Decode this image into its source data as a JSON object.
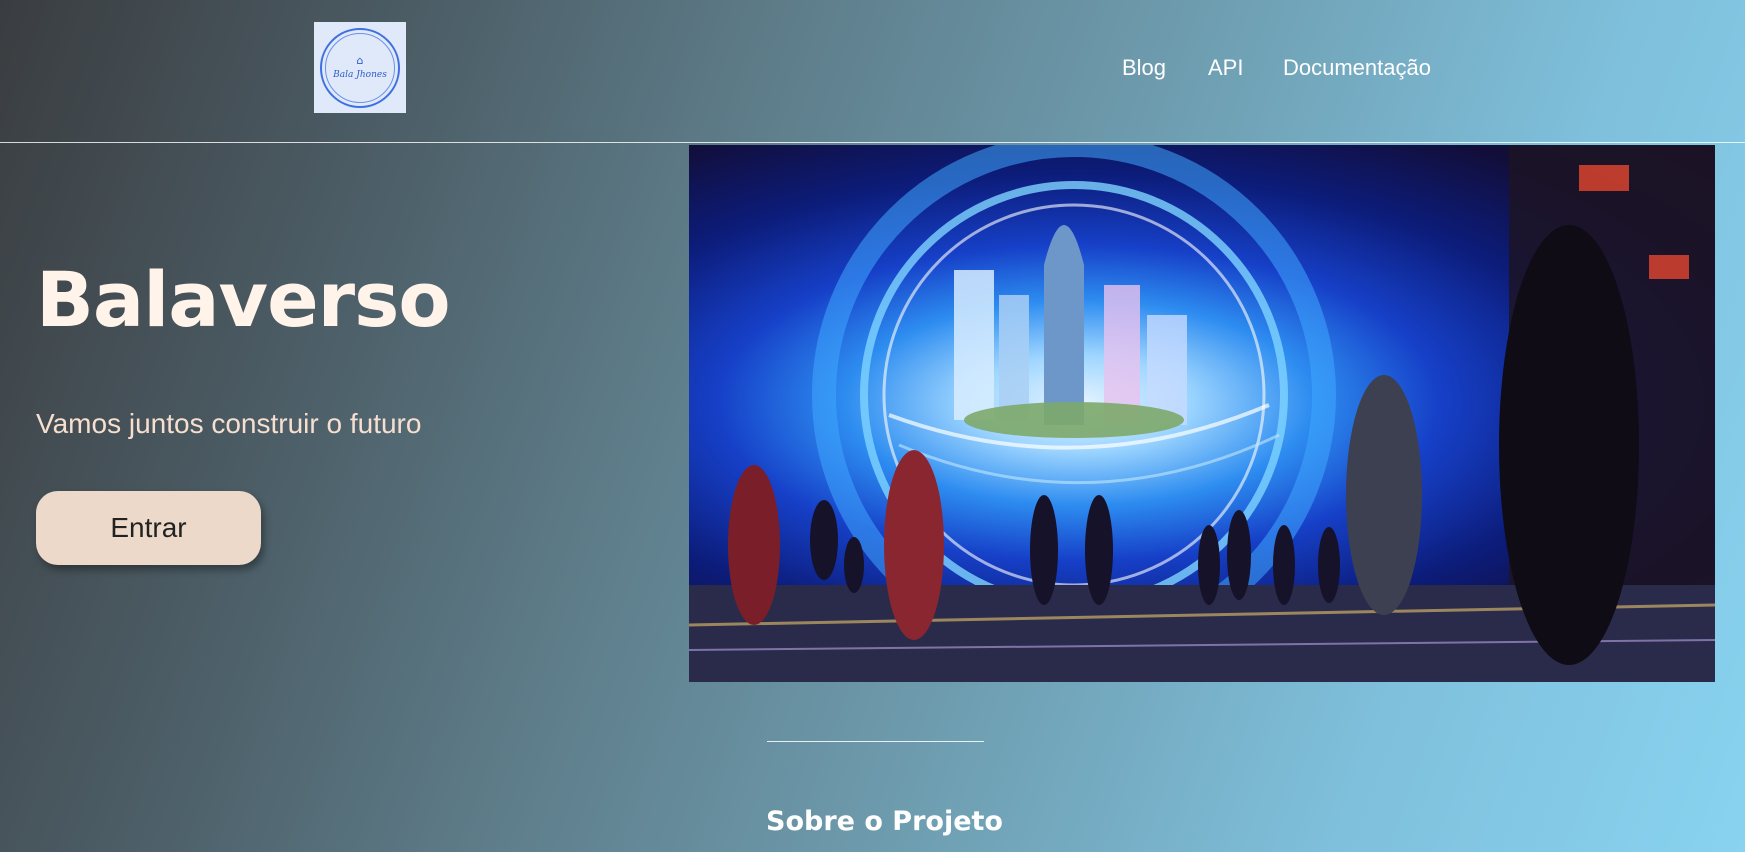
{
  "header": {
    "logo_text": "Bala Jhones",
    "nav": [
      {
        "label": "Blog"
      },
      {
        "label": "API"
      },
      {
        "label": "Documentação"
      }
    ]
  },
  "hero": {
    "title": "Balaverso",
    "subtitle": "Vamos juntos construir o futuro",
    "cta_label": "Entrar",
    "image_alt": "futuristic-portal-city-illustration"
  },
  "about": {
    "title": "Sobre o Projeto"
  },
  "colors": {
    "cta_background": "#ecd9ca",
    "title_color": "#fff3ea",
    "subtitle_color": "#f7dfd0"
  }
}
